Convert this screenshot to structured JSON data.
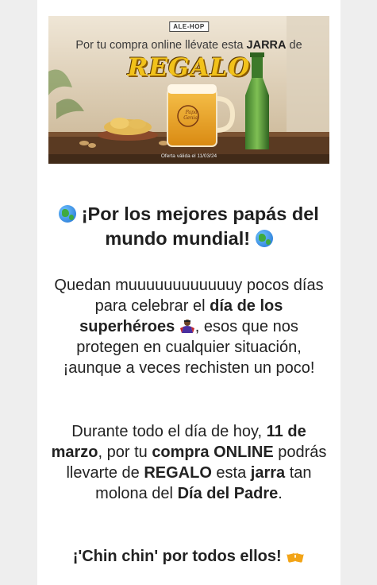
{
  "banner": {
    "brand": "ALE-HOP",
    "headline_pre": "Por tu compra online llévate esta ",
    "headline_bold": "JARRA",
    "headline_post": " de",
    "regalo": "REGALO",
    "mug_text": "Papá Genial",
    "valid_text": "Oferta válida el 11/03/24"
  },
  "title": {
    "text": "¡Por los mejores papás del mundo mundial!"
  },
  "p1": {
    "a": "Quedan muuuuuuuuuuuuy pocos días para celebrar el ",
    "b": "día de los superhéroes",
    "c": ", esos que nos protegen en cualquier situación, ¡aunque a veces rechisten un poco!"
  },
  "p2": {
    "a": "Durante todo el día de hoy, ",
    "b": "11 de marzo",
    "c": ", por tu ",
    "d": "compra ONLINE",
    "e": " podrás llevarte de ",
    "f": "REGALO",
    "g": " esta ",
    "h": "jarra",
    "i": " tan molona del ",
    "j": "Día del Padre",
    "k": "."
  },
  "p3": {
    "text": "¡'Chin chin' por todos ellos!"
  },
  "icons": {
    "globe": "globe-icon",
    "hero": "superhero-icon",
    "beer": "clinking-beer-mugs-icon"
  }
}
